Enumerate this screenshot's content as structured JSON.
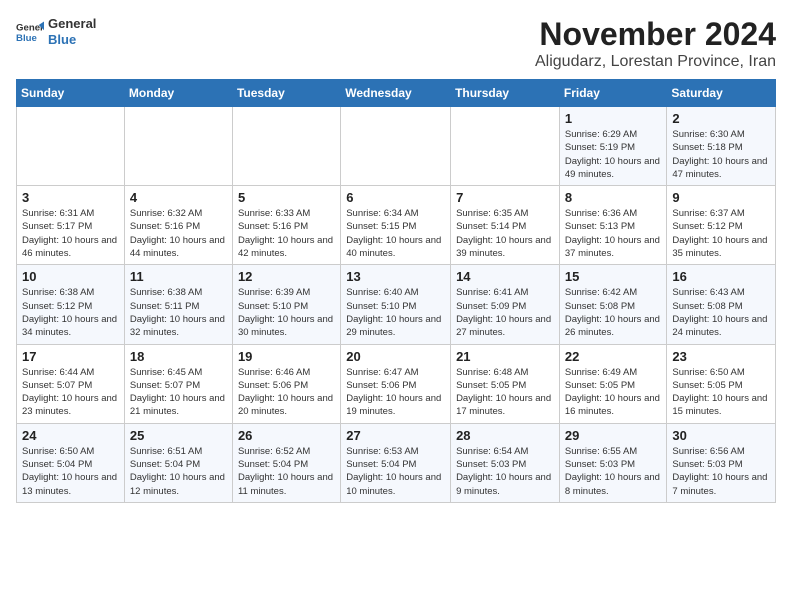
{
  "header": {
    "logo_line1": "General",
    "logo_line2": "Blue",
    "title": "November 2024",
    "subtitle": "Aligudarz, Lorestan Province, Iran"
  },
  "weekdays": [
    "Sunday",
    "Monday",
    "Tuesday",
    "Wednesday",
    "Thursday",
    "Friday",
    "Saturday"
  ],
  "weeks": [
    [
      {
        "day": "",
        "info": ""
      },
      {
        "day": "",
        "info": ""
      },
      {
        "day": "",
        "info": ""
      },
      {
        "day": "",
        "info": ""
      },
      {
        "day": "",
        "info": ""
      },
      {
        "day": "1",
        "info": "Sunrise: 6:29 AM\nSunset: 5:19 PM\nDaylight: 10 hours and 49 minutes."
      },
      {
        "day": "2",
        "info": "Sunrise: 6:30 AM\nSunset: 5:18 PM\nDaylight: 10 hours and 47 minutes."
      }
    ],
    [
      {
        "day": "3",
        "info": "Sunrise: 6:31 AM\nSunset: 5:17 PM\nDaylight: 10 hours and 46 minutes."
      },
      {
        "day": "4",
        "info": "Sunrise: 6:32 AM\nSunset: 5:16 PM\nDaylight: 10 hours and 44 minutes."
      },
      {
        "day": "5",
        "info": "Sunrise: 6:33 AM\nSunset: 5:16 PM\nDaylight: 10 hours and 42 minutes."
      },
      {
        "day": "6",
        "info": "Sunrise: 6:34 AM\nSunset: 5:15 PM\nDaylight: 10 hours and 40 minutes."
      },
      {
        "day": "7",
        "info": "Sunrise: 6:35 AM\nSunset: 5:14 PM\nDaylight: 10 hours and 39 minutes."
      },
      {
        "day": "8",
        "info": "Sunrise: 6:36 AM\nSunset: 5:13 PM\nDaylight: 10 hours and 37 minutes."
      },
      {
        "day": "9",
        "info": "Sunrise: 6:37 AM\nSunset: 5:12 PM\nDaylight: 10 hours and 35 minutes."
      }
    ],
    [
      {
        "day": "10",
        "info": "Sunrise: 6:38 AM\nSunset: 5:12 PM\nDaylight: 10 hours and 34 minutes."
      },
      {
        "day": "11",
        "info": "Sunrise: 6:38 AM\nSunset: 5:11 PM\nDaylight: 10 hours and 32 minutes."
      },
      {
        "day": "12",
        "info": "Sunrise: 6:39 AM\nSunset: 5:10 PM\nDaylight: 10 hours and 30 minutes."
      },
      {
        "day": "13",
        "info": "Sunrise: 6:40 AM\nSunset: 5:10 PM\nDaylight: 10 hours and 29 minutes."
      },
      {
        "day": "14",
        "info": "Sunrise: 6:41 AM\nSunset: 5:09 PM\nDaylight: 10 hours and 27 minutes."
      },
      {
        "day": "15",
        "info": "Sunrise: 6:42 AM\nSunset: 5:08 PM\nDaylight: 10 hours and 26 minutes."
      },
      {
        "day": "16",
        "info": "Sunrise: 6:43 AM\nSunset: 5:08 PM\nDaylight: 10 hours and 24 minutes."
      }
    ],
    [
      {
        "day": "17",
        "info": "Sunrise: 6:44 AM\nSunset: 5:07 PM\nDaylight: 10 hours and 23 minutes."
      },
      {
        "day": "18",
        "info": "Sunrise: 6:45 AM\nSunset: 5:07 PM\nDaylight: 10 hours and 21 minutes."
      },
      {
        "day": "19",
        "info": "Sunrise: 6:46 AM\nSunset: 5:06 PM\nDaylight: 10 hours and 20 minutes."
      },
      {
        "day": "20",
        "info": "Sunrise: 6:47 AM\nSunset: 5:06 PM\nDaylight: 10 hours and 19 minutes."
      },
      {
        "day": "21",
        "info": "Sunrise: 6:48 AM\nSunset: 5:05 PM\nDaylight: 10 hours and 17 minutes."
      },
      {
        "day": "22",
        "info": "Sunrise: 6:49 AM\nSunset: 5:05 PM\nDaylight: 10 hours and 16 minutes."
      },
      {
        "day": "23",
        "info": "Sunrise: 6:50 AM\nSunset: 5:05 PM\nDaylight: 10 hours and 15 minutes."
      }
    ],
    [
      {
        "day": "24",
        "info": "Sunrise: 6:50 AM\nSunset: 5:04 PM\nDaylight: 10 hours and 13 minutes."
      },
      {
        "day": "25",
        "info": "Sunrise: 6:51 AM\nSunset: 5:04 PM\nDaylight: 10 hours and 12 minutes."
      },
      {
        "day": "26",
        "info": "Sunrise: 6:52 AM\nSunset: 5:04 PM\nDaylight: 10 hours and 11 minutes."
      },
      {
        "day": "27",
        "info": "Sunrise: 6:53 AM\nSunset: 5:04 PM\nDaylight: 10 hours and 10 minutes."
      },
      {
        "day": "28",
        "info": "Sunrise: 6:54 AM\nSunset: 5:03 PM\nDaylight: 10 hours and 9 minutes."
      },
      {
        "day": "29",
        "info": "Sunrise: 6:55 AM\nSunset: 5:03 PM\nDaylight: 10 hours and 8 minutes."
      },
      {
        "day": "30",
        "info": "Sunrise: 6:56 AM\nSunset: 5:03 PM\nDaylight: 10 hours and 7 minutes."
      }
    ]
  ]
}
